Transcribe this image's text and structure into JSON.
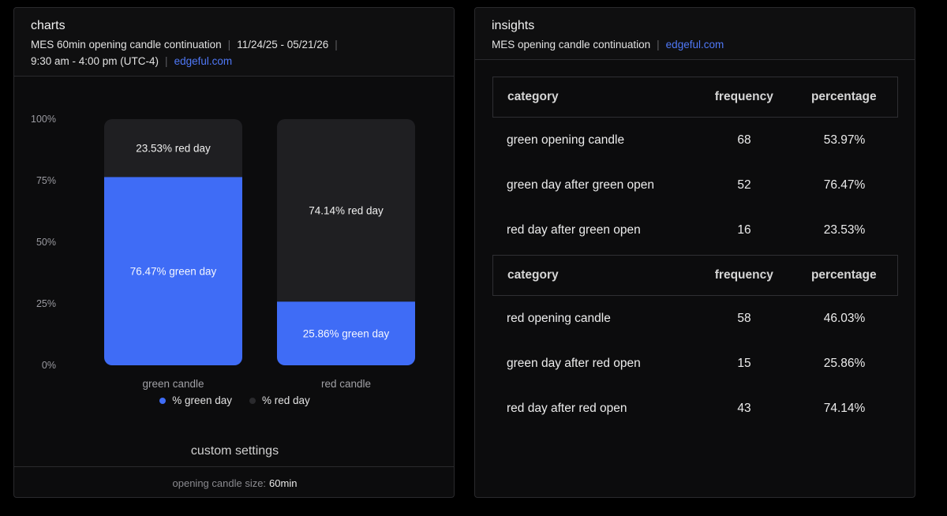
{
  "charts": {
    "title": "charts",
    "subtitle_parts": [
      "MES 60min opening candle continuation",
      "11/24/25 - 05/21/26",
      "9:30 am - 4:00 pm (UTC-4)"
    ],
    "link": "edgeful.com",
    "custom_settings_title": "custom settings",
    "setting_label": "opening candle size:",
    "setting_value": "60min"
  },
  "insights": {
    "title": "insights",
    "subtitle": "MES opening candle continuation",
    "link": "edgeful.com",
    "headers": [
      "category",
      "frequency",
      "percentage"
    ],
    "groups": [
      {
        "rows": [
          [
            "green opening candle",
            "68",
            "53.97%"
          ],
          [
            "green day after green open",
            "52",
            "76.47%"
          ],
          [
            "red day after green open",
            "16",
            "23.53%"
          ]
        ]
      },
      {
        "rows": [
          [
            "red opening candle",
            "58",
            "46.03%"
          ],
          [
            "green day after red open",
            "15",
            "25.86%"
          ],
          [
            "red day after red open",
            "43",
            "74.14%"
          ]
        ]
      }
    ]
  },
  "chart_data": {
    "type": "bar",
    "stacked": true,
    "categories": [
      "green candle",
      "red candle"
    ],
    "series": [
      {
        "name": "% green day",
        "values": [
          76.47,
          25.86
        ],
        "color": "#3f6cf6",
        "labels": [
          "76.47% green day",
          "25.86% green day"
        ]
      },
      {
        "name": "% red day",
        "values": [
          23.53,
          74.14
        ],
        "color": "#1f1f22",
        "labels": [
          "23.53% red day",
          "74.14% red day"
        ]
      }
    ],
    "y_ticks": [
      "0%",
      "25%",
      "50%",
      "75%",
      "100%"
    ],
    "ylim": [
      0,
      100
    ],
    "grid": false,
    "legend": "bottom-center"
  }
}
